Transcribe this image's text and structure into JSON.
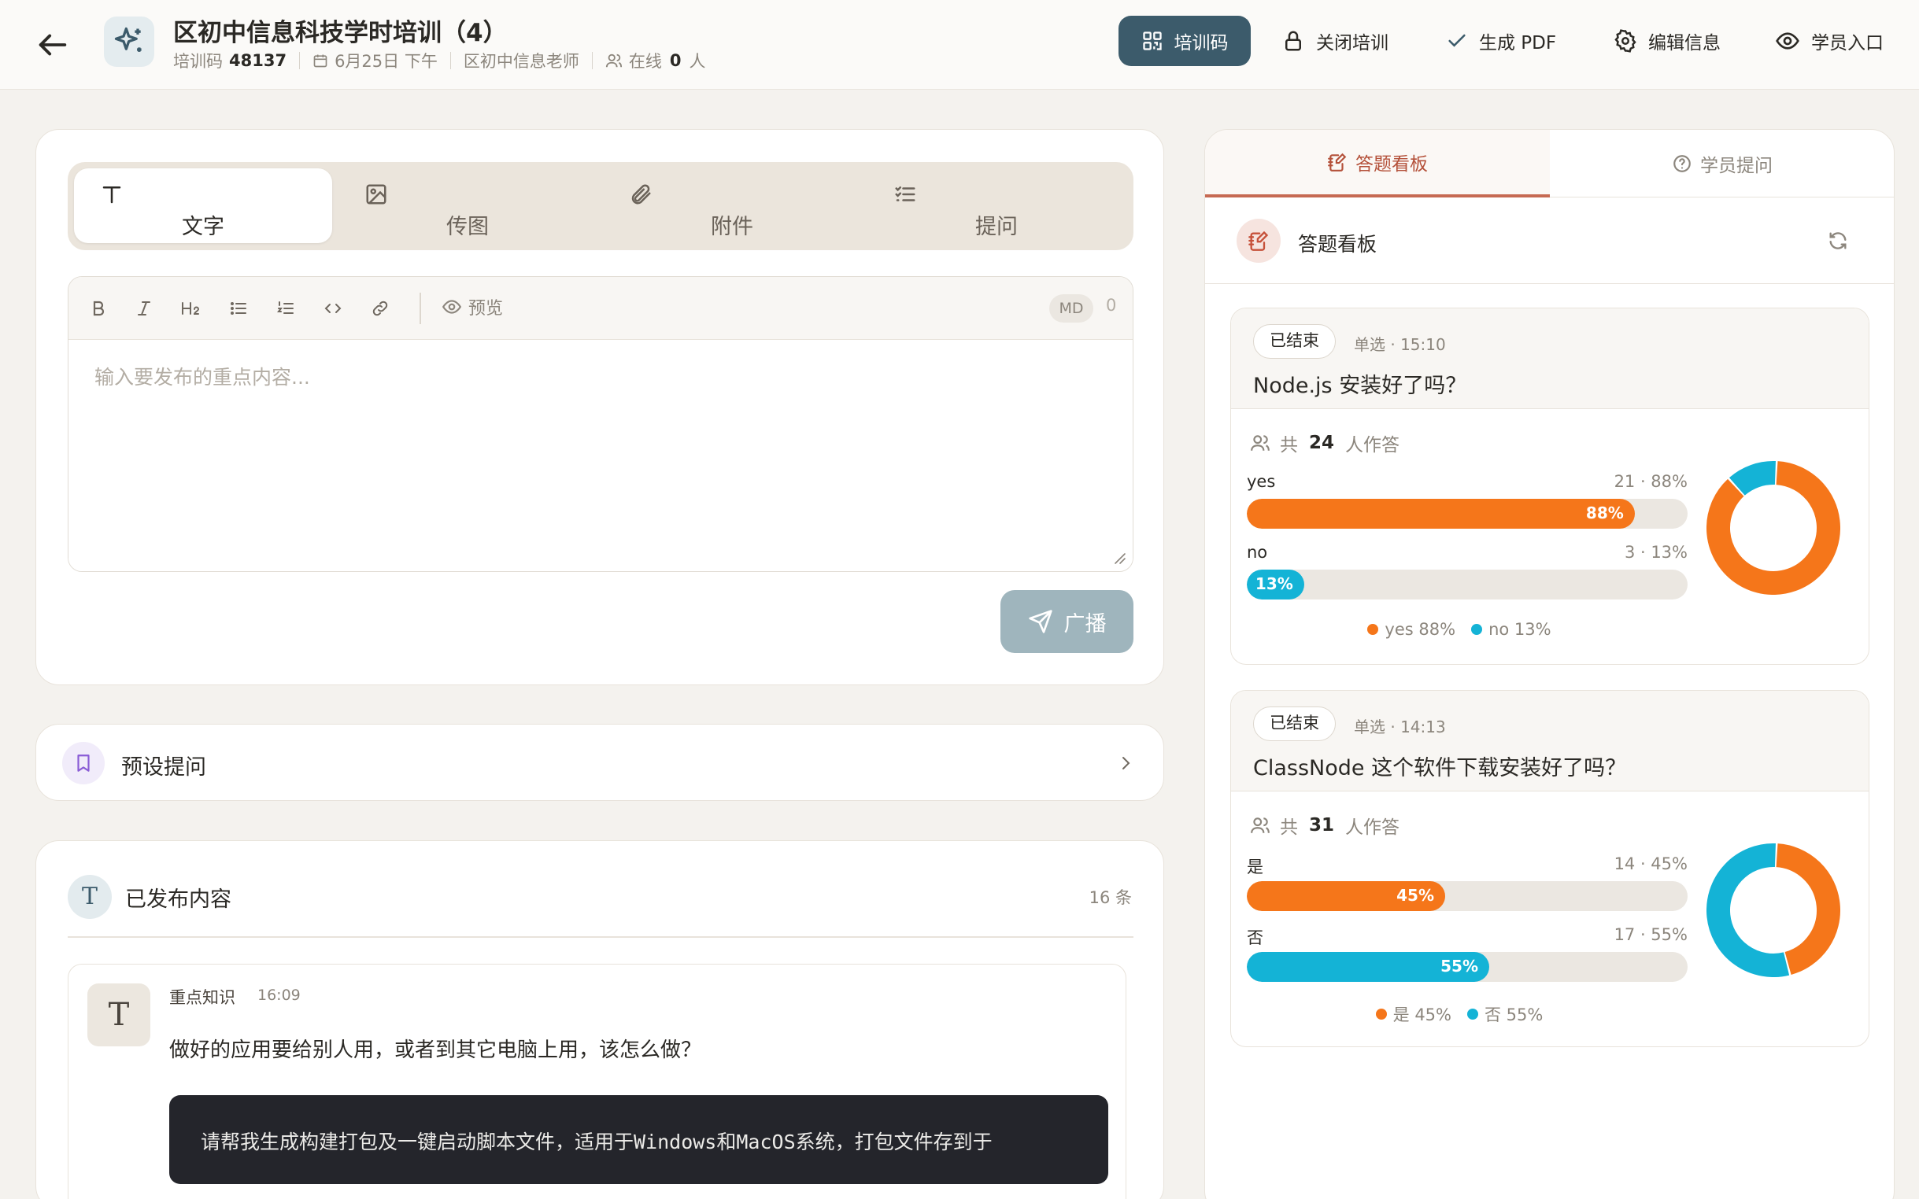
{
  "header": {
    "title": "区初中信息科技学时培训（4）",
    "code_label": "培训码",
    "code_value": "48137",
    "date": "6月25日 下午",
    "teacher": "区初中信息老师",
    "online_label": "在线",
    "online_count": "0",
    "online_unit": "人",
    "buttons": {
      "qr": "培训码",
      "close": "关闭培训",
      "pdf": "生成 PDF",
      "edit": "编辑信息",
      "student": "学员入口"
    }
  },
  "compose": {
    "tabs": [
      "文字",
      "传图",
      "附件",
      "提问"
    ],
    "active_tab": 0,
    "preview": "预览",
    "md_badge": "MD",
    "char_count": "0",
    "placeholder": "输入要发布的重点内容...",
    "broadcast": "广播"
  },
  "preset": {
    "label": "预设提问"
  },
  "published": {
    "title": "已发布内容",
    "count": "16 条",
    "message": {
      "tag": "重点知识",
      "time": "16:09",
      "text": "做好的应用要给别人用，或者到其它电脑上用，该怎么做？",
      "code": "请帮我生成构建打包及一键启动脚本文件，适用于Windows和MacOS系统，打包文件存到于"
    }
  },
  "right": {
    "tabs": [
      "答题看板",
      "学员提问"
    ],
    "active_tab": 0,
    "panel_title": "答题看板",
    "questions": [
      {
        "status": "已结束",
        "meta": "单选 · 15:10",
        "title": "Node.js 安装好了吗？",
        "total_prefix": "共",
        "total": "24",
        "total_suffix": "人作答",
        "options": [
          {
            "label": "yes",
            "count": 21,
            "percent": 88,
            "stats": "21 · 88%",
            "bar_text": "88%",
            "legend": "yes 88%",
            "color": "#f5761a"
          },
          {
            "label": "no",
            "count": 3,
            "percent": 13,
            "stats": "3 · 13%",
            "bar_text": "13%",
            "legend": "no 13%",
            "color": "#14b3d6"
          }
        ]
      },
      {
        "status": "已结束",
        "meta": "单选 · 14:13",
        "title": "ClassNode 这个软件下载安装好了吗？",
        "total_prefix": "共",
        "total": "31",
        "total_suffix": "人作答",
        "options": [
          {
            "label": "是",
            "count": 14,
            "percent": 45,
            "stats": "14 · 45%",
            "bar_text": "45%",
            "legend": "是 45%",
            "color": "#f5761a"
          },
          {
            "label": "否",
            "count": 17,
            "percent": 55,
            "stats": "17 · 55%",
            "bar_text": "55%",
            "legend": "否 55%",
            "color": "#14b3d6"
          }
        ]
      }
    ]
  },
  "colors": {
    "accent": "#3c5b6b",
    "orange": "#f5761a",
    "cyan": "#14b3d6",
    "active_tab": "#b4513a"
  }
}
